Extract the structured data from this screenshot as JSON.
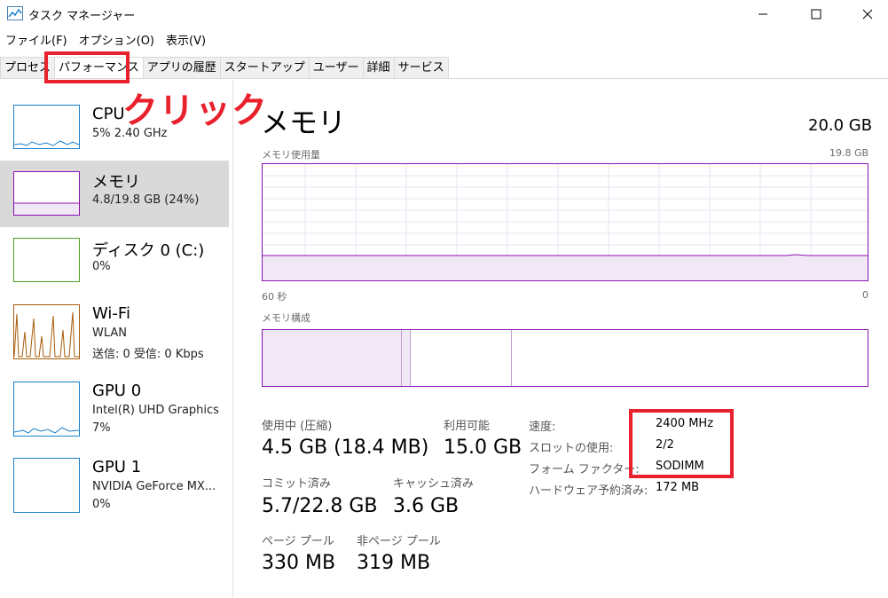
{
  "window": {
    "title": "タスク マネージャー"
  },
  "menu": [
    "ファイル(F)",
    "オプション(O)",
    "表示(V)"
  ],
  "tabs": [
    "プロセス",
    "パフォーマンス",
    "アプリの履歴",
    "スタートアップ",
    "ユーザー",
    "詳細",
    "サービス"
  ],
  "active_tab": "パフォーマンス",
  "annotation": {
    "click_text": "クリック"
  },
  "sidebar": [
    {
      "name": "CPU",
      "line1": "5% 2.40 GHz",
      "line2": "",
      "color": "#1a7fc9"
    },
    {
      "name": "メモリ",
      "line1": "4.8/19.8 GB (24%)",
      "line2": "",
      "color": "#8b12ae"
    },
    {
      "name": "ディスク 0 (C:)",
      "line1": "0%",
      "line2": "",
      "color": "#4da01f"
    },
    {
      "name": "Wi-Fi",
      "line1": "WLAN",
      "line2": "送信: 0 受信: 0 Kbps",
      "color": "#a75c0c"
    },
    {
      "name": "GPU 0",
      "line1": "Intel(R) UHD Graphics",
      "line2": "7%",
      "color": "#1a7fc9"
    },
    {
      "name": "GPU 1",
      "line1": "NVIDIA GeForce MX...",
      "line2": "0%",
      "color": "#1a7fc9"
    }
  ],
  "main": {
    "title": "メモリ",
    "total": "20.0 GB",
    "graph_label": "メモリ使用量",
    "graph_max": "19.8 GB",
    "graph_time": "60 秒",
    "graph_zero": "0",
    "comp_label": "メモリ構成",
    "stats": {
      "in_use_label": "使用中 (圧縮)",
      "in_use_value": "4.5 GB (18.4 MB)",
      "available_label": "利用可能",
      "available_value": "15.0 GB",
      "committed_label": "コミット済み",
      "committed_value": "5.7/22.8 GB",
      "cached_label": "キャッシュ済み",
      "cached_value": "3.6 GB",
      "paged_label": "ページ プール",
      "paged_value": "330 MB",
      "nonpaged_label": "非ページ プール",
      "nonpaged_value": "319 MB"
    },
    "info": [
      {
        "label": "速度:",
        "value": "2400 MHz"
      },
      {
        "label": "スロットの使用:",
        "value": "2/2"
      },
      {
        "label": "フォーム ファクター:",
        "value": "SODIMM"
      },
      {
        "label": "ハードウェア予約済み:",
        "value": "172 MB"
      }
    ]
  }
}
